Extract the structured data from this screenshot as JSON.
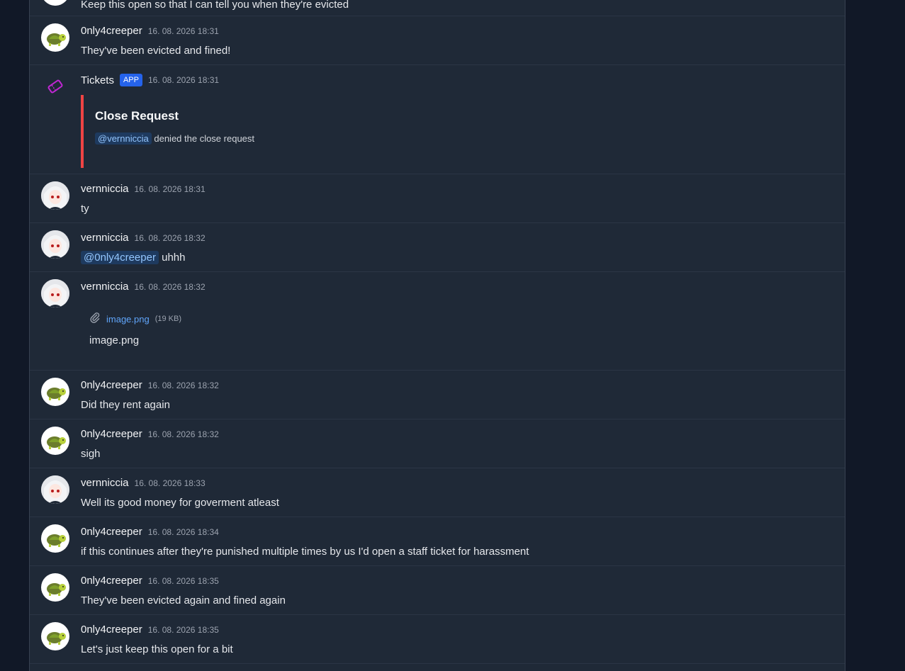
{
  "partial_message": {
    "text": "Keep this open so that I can tell you when they're evicted"
  },
  "messages": [
    {
      "author": "0nly4creeper",
      "avatar": "turtle-avatar",
      "time": "16. 08. 2026 18:31",
      "text": "They've been evicted and fined!"
    },
    {
      "author": "Tickets",
      "badge": "APP",
      "avatar": "ticket-icon",
      "time": "16. 08. 2026 18:31",
      "embed": {
        "title": "Close Request",
        "mention": "@vernniccia",
        "text": "denied the close request",
        "color": "#ef4444"
      }
    },
    {
      "author": "vernniccia",
      "avatar": "anime-girl-avatar",
      "time": "16. 08. 2026 18:31",
      "text": "ty"
    },
    {
      "author": "vernniccia",
      "avatar": "anime-girl-avatar",
      "time": "16. 08. 2026 18:32",
      "mention": "@0nly4creeper",
      "text": "uhhh"
    },
    {
      "author": "vernniccia",
      "avatar": "anime-girl-avatar",
      "time": "16. 08. 2026 18:32",
      "attachment": {
        "icon": "paperclip-icon",
        "name": "image.png",
        "size": "(19 KB)",
        "caption": "image.png"
      }
    },
    {
      "author": "0nly4creeper",
      "avatar": "turtle-avatar",
      "time": "16. 08. 2026 18:32",
      "text": "Did they rent again"
    },
    {
      "author": "0nly4creeper",
      "avatar": "turtle-avatar",
      "time": "16. 08. 2026 18:32",
      "text": "sigh"
    },
    {
      "author": "vernniccia",
      "avatar": "anime-girl-avatar",
      "time": "16. 08. 2026 18:33",
      "text": "Well its good money for goverment atleast"
    },
    {
      "author": "0nly4creeper",
      "avatar": "turtle-avatar",
      "time": "16. 08. 2026 18:34",
      "text": "if this continues after they're punished multiple times by us I'd open a staff ticket for harassment"
    },
    {
      "author": "0nly4creeper",
      "avatar": "turtle-avatar",
      "time": "16. 08. 2026 18:35",
      "text": "They've been evicted again and fined again"
    },
    {
      "author": "0nly4creeper",
      "avatar": "turtle-avatar",
      "time": "16. 08. 2026 18:35",
      "text": "Let's just keep this open for a bit"
    }
  ],
  "colors": {
    "background": "#111827",
    "panel": "#1f2937",
    "mention_bg": "#1e3a5f",
    "mention_fg": "#93c5fd",
    "badge": "#2563eb",
    "link": "#60a5fa"
  }
}
